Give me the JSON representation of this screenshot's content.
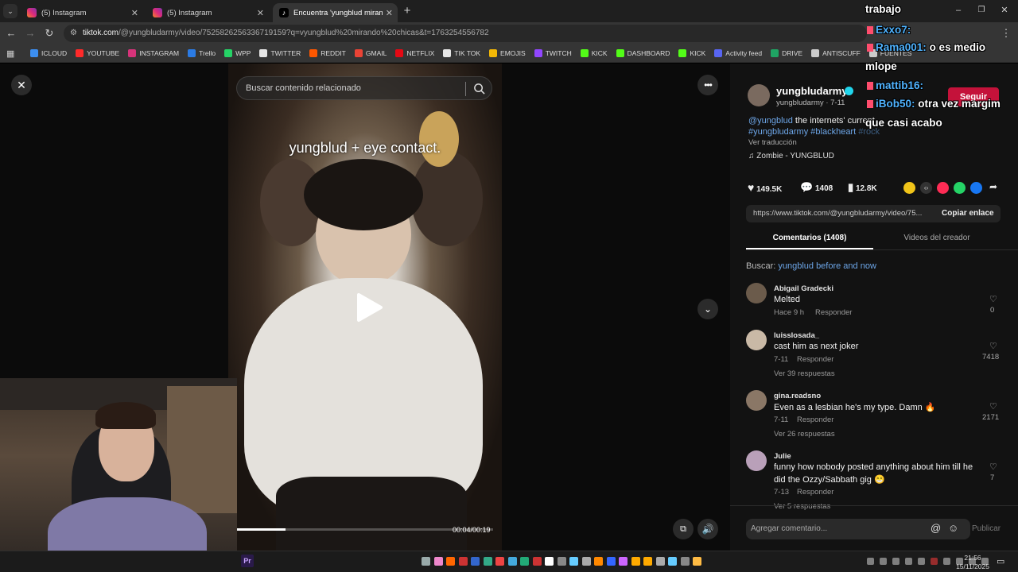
{
  "tabs": [
    {
      "title": "(5) Instagram",
      "active": false
    },
    {
      "title": "(5) Instagram",
      "active": false
    },
    {
      "title": "Encuentra 'yungblud mirando",
      "active": true
    }
  ],
  "address": {
    "domain": "tiktok.com",
    "path": "/@yungbludarmy/video/7525826256336719159?q=vyungblud%20mirando%20chicas&t=1763254556782"
  },
  "bookmarks": [
    {
      "label": "ICLOUD",
      "color": "#3c8ef0"
    },
    {
      "label": "YOUTUBE",
      "color": "#ff2a2a"
    },
    {
      "label": "INSTAGRAM",
      "color": "#d6337a"
    },
    {
      "label": "Trello",
      "color": "#2b7be4"
    },
    {
      "label": "WPP",
      "color": "#25d366"
    },
    {
      "label": "TWITTER",
      "color": "#e6e6e6"
    },
    {
      "label": "REDDIT",
      "color": "#ff5700"
    },
    {
      "label": "GMAIL",
      "color": "#ea4335"
    },
    {
      "label": "NETFLIX",
      "color": "#e50914"
    },
    {
      "label": "TIK TOK",
      "color": "#e6e6e6"
    },
    {
      "label": "EMOJIS",
      "color": "#f2b705"
    },
    {
      "label": "TWITCH",
      "color": "#9146ff"
    },
    {
      "label": "KICK",
      "color": "#53fc18"
    },
    {
      "label": "DASHBOARD",
      "color": "#53fc18"
    },
    {
      "label": "KICK",
      "color": "#53fc18"
    },
    {
      "label": "Activity feed",
      "color": "#5865f2"
    },
    {
      "label": "DRIVE",
      "color": "#1fa463"
    },
    {
      "label": "ANTISCUFF",
      "color": "#cccccc"
    },
    {
      "label": "FUENTES",
      "color": "#cccccc"
    }
  ],
  "video": {
    "search_placeholder": "Buscar contenido relacionado",
    "caption": "yungblud + eye contact.",
    "time": "00:04/00:19",
    "progress": 0.19
  },
  "author": {
    "name": "yungbludarmy",
    "handle": "yungbludarmy",
    "date": "· 7-11",
    "follow_label": "Seguir",
    "desc_mention": "@yungblud",
    "desc_text": " the internets' current",
    "desc_tag1": "#yungblud",
    "desc_tag2": "#yungbludarmy",
    "desc_tag3": "#blackheart",
    "desc_tag4": "#rock",
    "translate": "Ver traducción",
    "music": "Zombie - YUNGBLUD"
  },
  "stats": {
    "likes": "149.5K",
    "comments": "1408",
    "saves": "12.8K"
  },
  "share": {
    "url": "https://www.tiktok.com/@yungbludarmy/video/75...",
    "copy_label": "Copiar enlace"
  },
  "panel_tabs": {
    "comments": "Comentarios (1408)",
    "creator": "Videos del creador"
  },
  "search_suggest": {
    "label": "Buscar:",
    "query": "yungblud before and now"
  },
  "comments": [
    {
      "name": "Abigail Gradecki",
      "text": "Melted",
      "meta": "Hace 9 h",
      "reply": "Responder",
      "likes": "0",
      "replies": "",
      "avatar": "#6b5b4b"
    },
    {
      "name": "luisslosada_",
      "text": "cast him as next joker",
      "meta": "7-11",
      "reply": "Responder",
      "likes": "7418",
      "replies": "Ver 39 respuestas",
      "avatar": "#c9b9a6"
    },
    {
      "name": "gina.readsno",
      "text": "Even as a lesbian he's my type. Damn 🔥",
      "meta": "7-11",
      "reply": "Responder",
      "likes": "2171",
      "replies": "Ver 26 respuestas",
      "avatar": "#8a7766"
    },
    {
      "name": "Julie",
      "text": "funny how nobody posted anything about him till he",
      "text2": "did the Ozzy/Sabbath gig 😁",
      "meta": "7-13",
      "reply": "Responder",
      "likes": "7",
      "replies": "Ver 5 respuestas",
      "avatar": "#b9a0b9"
    }
  ],
  "comment_input": {
    "placeholder": "Agregar comentario...",
    "publish": "Publicar"
  },
  "overlay_chat": {
    "title": "trabajo",
    "lines": [
      {
        "user": "Exxo7:",
        "msg": ""
      },
      {
        "user": "Rama001:",
        "msg": "o es medio"
      },
      {
        "user": "",
        "msg": "mlope"
      },
      {
        "user": "mattib16:",
        "msg": ""
      },
      {
        "user": "iBob50:",
        "msg": "otra vez margim"
      },
      {
        "user": "",
        "msg": "que casi acabo"
      }
    ]
  },
  "taskbar": {
    "time": "21:56",
    "date": "15/11/2025",
    "app": "Pr"
  }
}
